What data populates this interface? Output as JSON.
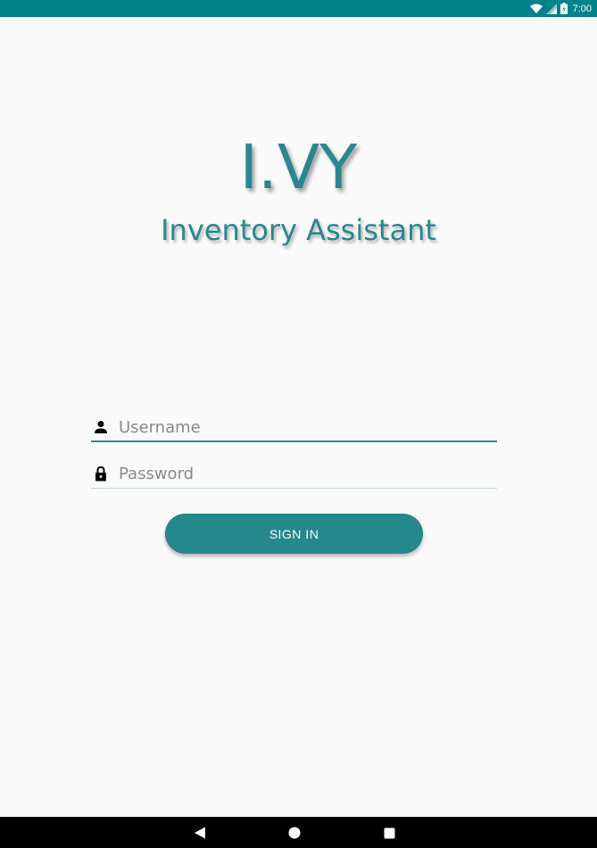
{
  "status_bar": {
    "time": "7:00",
    "background": "#00838a",
    "icons": [
      "wifi-icon",
      "signal-icon",
      "battery-icon"
    ]
  },
  "brand": {
    "title": "I.VY",
    "subtitle": "Inventory Assistant",
    "color": "#2a8790"
  },
  "login_form": {
    "username": {
      "placeholder": "Username",
      "value": "",
      "icon": "person-icon"
    },
    "password": {
      "placeholder": "Password",
      "value": "",
      "icon": "lock-icon"
    },
    "sign_in_label": "SIGN IN",
    "button_color": "#26878c"
  },
  "nav_bar": {
    "buttons": [
      "back-icon",
      "home-icon",
      "recents-icon"
    ]
  }
}
